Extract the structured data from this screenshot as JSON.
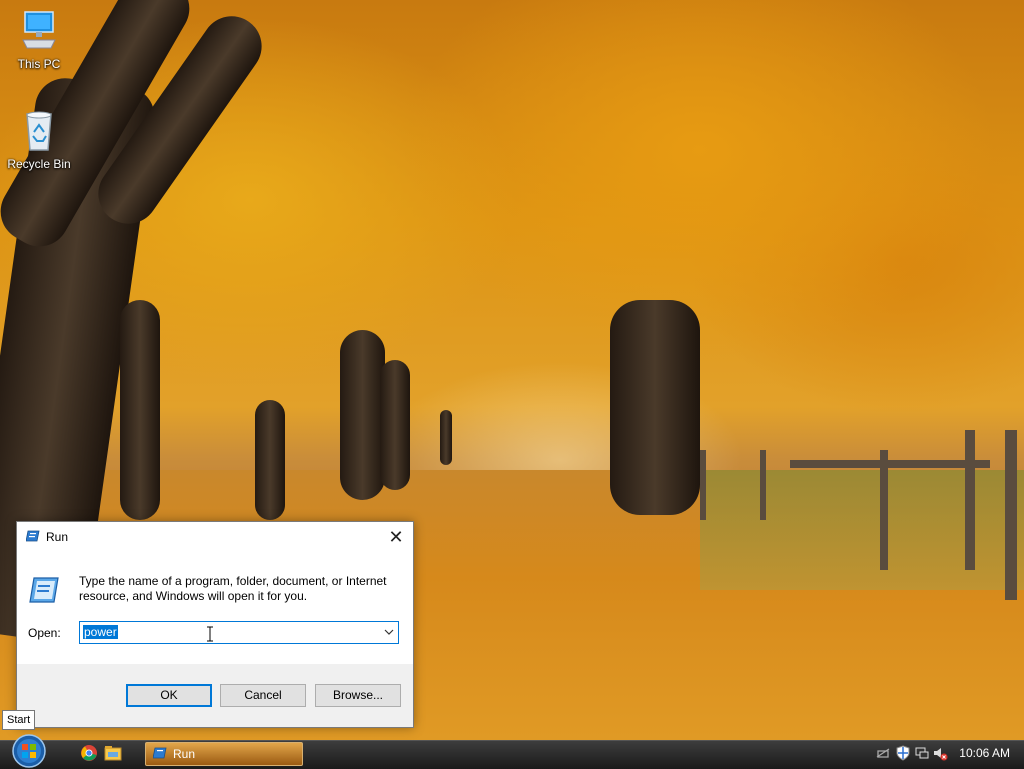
{
  "desktop": {
    "icons": [
      {
        "label": "This PC",
        "icon": "computer-icon"
      },
      {
        "label": "Recycle Bin",
        "icon": "recycle-bin-icon"
      }
    ]
  },
  "run_dialog": {
    "title": "Run",
    "description": "Type the name of a program, folder, document, or Internet resource, and Windows will open it for you.",
    "open_label": "Open:",
    "input_value": "power",
    "buttons": {
      "ok": "OK",
      "cancel": "Cancel",
      "browse": "Browse..."
    }
  },
  "tooltip": {
    "text": "Start"
  },
  "taskbar": {
    "pinned": [
      "chrome-icon",
      "file-explorer-icon"
    ],
    "tasks": [
      {
        "label": "Run"
      }
    ],
    "clock": "10:06 AM",
    "tray_icons": [
      "network-disabled-icon",
      "security-shield-icon",
      "network-icon",
      "volume-muted-icon"
    ]
  },
  "colors": {
    "accent": "#0078d7",
    "taskbar_task": "#c8821e"
  }
}
